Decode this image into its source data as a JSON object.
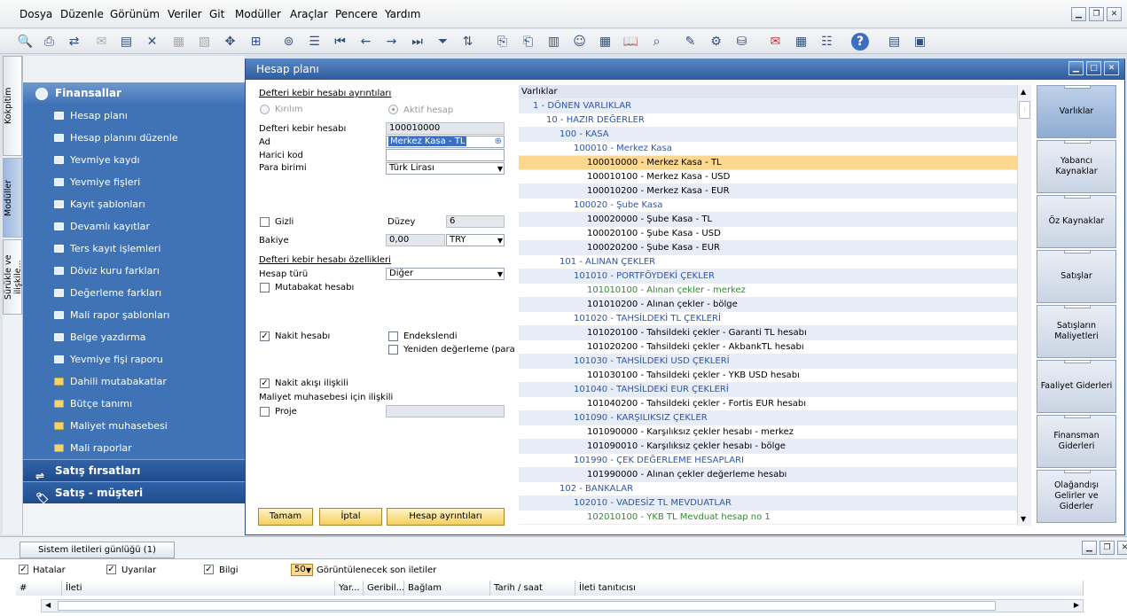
{
  "menu": [
    "Dosya",
    "Düzenle",
    "Görünüm",
    "Veriler",
    "Git",
    "Modüller",
    "Araçlar",
    "Pencere",
    "Yardım"
  ],
  "left_tabs": [
    "Kokpitim",
    "Modüller",
    "Sürükle ve ilişkile..."
  ],
  "nav": {
    "section_top": "Finansallar",
    "items": [
      "Hesap planı",
      "Hesap planını düzenle",
      "Yevmiye kaydı",
      "Yevmiye fişleri",
      "Kayıt şablonları",
      "Devamlı kayıtlar",
      "Ters kayıt işlemleri",
      "Döviz kuru farkları",
      "Değerleme farkları",
      "Mali rapor şablonları",
      "Belge yazdırma",
      "Yevmiye fişi raporu",
      "Dahili mutabakatlar",
      "Bütçe tanımı",
      "Maliyet muhasebesi",
      "Mali raporlar"
    ],
    "sections_bottom": [
      "Satış fırsatları",
      "Satış - müşteri"
    ]
  },
  "window": {
    "title": "Hesap planı"
  },
  "form": {
    "details_title": "Defteri kebir hesabı ayrıntıları",
    "radio_kirilim": "Kırılım",
    "radio_aktif": "Aktif hesap",
    "gl_label": "Defteri kebir hesabı",
    "gl_value": "100010000",
    "ad_label": "Ad",
    "ad_value": "Merkez Kasa  - TL",
    "harici_label": "Harici kod",
    "harici_value": "",
    "para_label": "Para birimi",
    "para_value": "Türk Lirası",
    "gizli_label": "Gizli",
    "duzey_label": "Düzey",
    "duzey_value": "6",
    "bakiye_label": "Bakiye",
    "bakiye_value": "0,00",
    "bakiye_currency": "TRY",
    "props_title": "Defteri kebir hesabı özellikleri",
    "hesap_turu_label": "Hesap türü",
    "hesap_turu_value": "Diğer",
    "mutabakat_label": "Mutabakat hesabı",
    "nakit_label": "Nakit hesabı",
    "endeks_label": "Endekslendi",
    "yeniden_label": "Yeniden değerleme (para",
    "nakit_akisi_label": "Nakit akışı ilişkili",
    "maliyet_label": "Maliyet muhasebesi için ilişkili",
    "proje_label": "Proje",
    "btn_ok": "Tamam",
    "btn_cancel": "İptal",
    "btn_details": "Hesap ayrıntıları"
  },
  "tree": {
    "header": "Varlıklar",
    "rows": [
      {
        "text": "1 - DÖNEN VARLIKLAR",
        "level": 1,
        "style": "title"
      },
      {
        "text": "10 - HAZIR DEĞERLER",
        "level": 2,
        "style": "title"
      },
      {
        "text": "100 - KASA",
        "level": 3,
        "style": "title"
      },
      {
        "text": "100010 - Merkez Kasa",
        "level": 4,
        "style": "title"
      },
      {
        "text": "100010000 - Merkez Kasa  - TL",
        "level": 5,
        "style": "active",
        "selected": true
      },
      {
        "text": "100010100 - Merkez Kasa - USD",
        "level": 5,
        "style": "active"
      },
      {
        "text": "100010200 - Merkez Kasa - EUR",
        "level": 5,
        "style": "active"
      },
      {
        "text": "100020 - Şube Kasa",
        "level": 4,
        "style": "title"
      },
      {
        "text": "100020000 - Şube Kasa - TL",
        "level": 5,
        "style": "active"
      },
      {
        "text": "100020100 - Şube Kasa - USD",
        "level": 5,
        "style": "active"
      },
      {
        "text": "100020200 - Şube Kasa - EUR",
        "level": 5,
        "style": "active"
      },
      {
        "text": "101 - ALINAN ÇEKLER",
        "level": 3,
        "style": "title"
      },
      {
        "text": "101010 - PORTFÖYDEKİ ÇEKLER",
        "level": 4,
        "style": "title"
      },
      {
        "text": "101010100 - Alınan çekler - merkez",
        "level": 5,
        "style": "green"
      },
      {
        "text": "101010200 - Alınan çekler - bölge",
        "level": 5,
        "style": "active"
      },
      {
        "text": "101020 - TAHSİLDEKİ TL ÇEKLERİ",
        "level": 4,
        "style": "title"
      },
      {
        "text": "101020100 - Tahsildeki çekler - Garanti TL hesabı",
        "level": 5,
        "style": "active"
      },
      {
        "text": "101020200 - Tahsildeki çekler - AkbankTL hesabı",
        "level": 5,
        "style": "active"
      },
      {
        "text": "101030 - TAHSİLDEKİ USD ÇEKLERİ",
        "level": 4,
        "style": "title"
      },
      {
        "text": "101030100 - Tahsildeki çekler - YKB USD hesabı",
        "level": 5,
        "style": "active"
      },
      {
        "text": "101040 - TAHSİLDEKİ EUR ÇEKLERİ",
        "level": 4,
        "style": "title"
      },
      {
        "text": "101040200 - Tahsildeki çekler - Fortis EUR hesabı",
        "level": 5,
        "style": "active"
      },
      {
        "text": "101090 - KARŞILIKSIZ ÇEKLER",
        "level": 4,
        "style": "title"
      },
      {
        "text": "101090000 - Karşılıksız çekler hesabı - merkez",
        "level": 5,
        "style": "active"
      },
      {
        "text": "101090010 - Karşılıksız çekler hesabı - bölge",
        "level": 5,
        "style": "active"
      },
      {
        "text": "101990 - ÇEK DEĞERLEME HESAPLARI",
        "level": 4,
        "style": "title"
      },
      {
        "text": "101990000 - Alınan çekler değerleme hesabı",
        "level": 5,
        "style": "active"
      },
      {
        "text": "102 - BANKALAR",
        "level": 3,
        "style": "title"
      },
      {
        "text": "102010 - VADESİZ TL MEVDUATLAR",
        "level": 4,
        "style": "title"
      },
      {
        "text": "102010100 - YKB TL Mevduat hesap no 1",
        "level": 5,
        "style": "green"
      }
    ]
  },
  "right_tabs": [
    "Varlıklar",
    "Yabancı Kaynaklar",
    "Öz Kaynaklar",
    "Satışlar",
    "Satışların Maliyetleri",
    "Faaliyet Giderleri",
    "Finansman Giderleri",
    "Olağandışı Gelirler ve Giderler"
  ],
  "log": {
    "tab": "Sistem iletileri günlüğü (1)",
    "hatalar": "Hatalar",
    "uyarilar": "Uyarılar",
    "bilgi": "Bilgi",
    "count": "50",
    "count_label": "Görüntülenecek son iletiler",
    "columns": [
      "#",
      "İleti",
      "Yar...",
      "Geribil...",
      "Bağlam",
      "Tarih / saat",
      "İleti tanıtıcısı"
    ]
  },
  "colors": {
    "accent": "#3f73b5",
    "selected": "#fcd790",
    "tree_title": "#2a55b0",
    "tree_green": "#2e8b2e"
  }
}
